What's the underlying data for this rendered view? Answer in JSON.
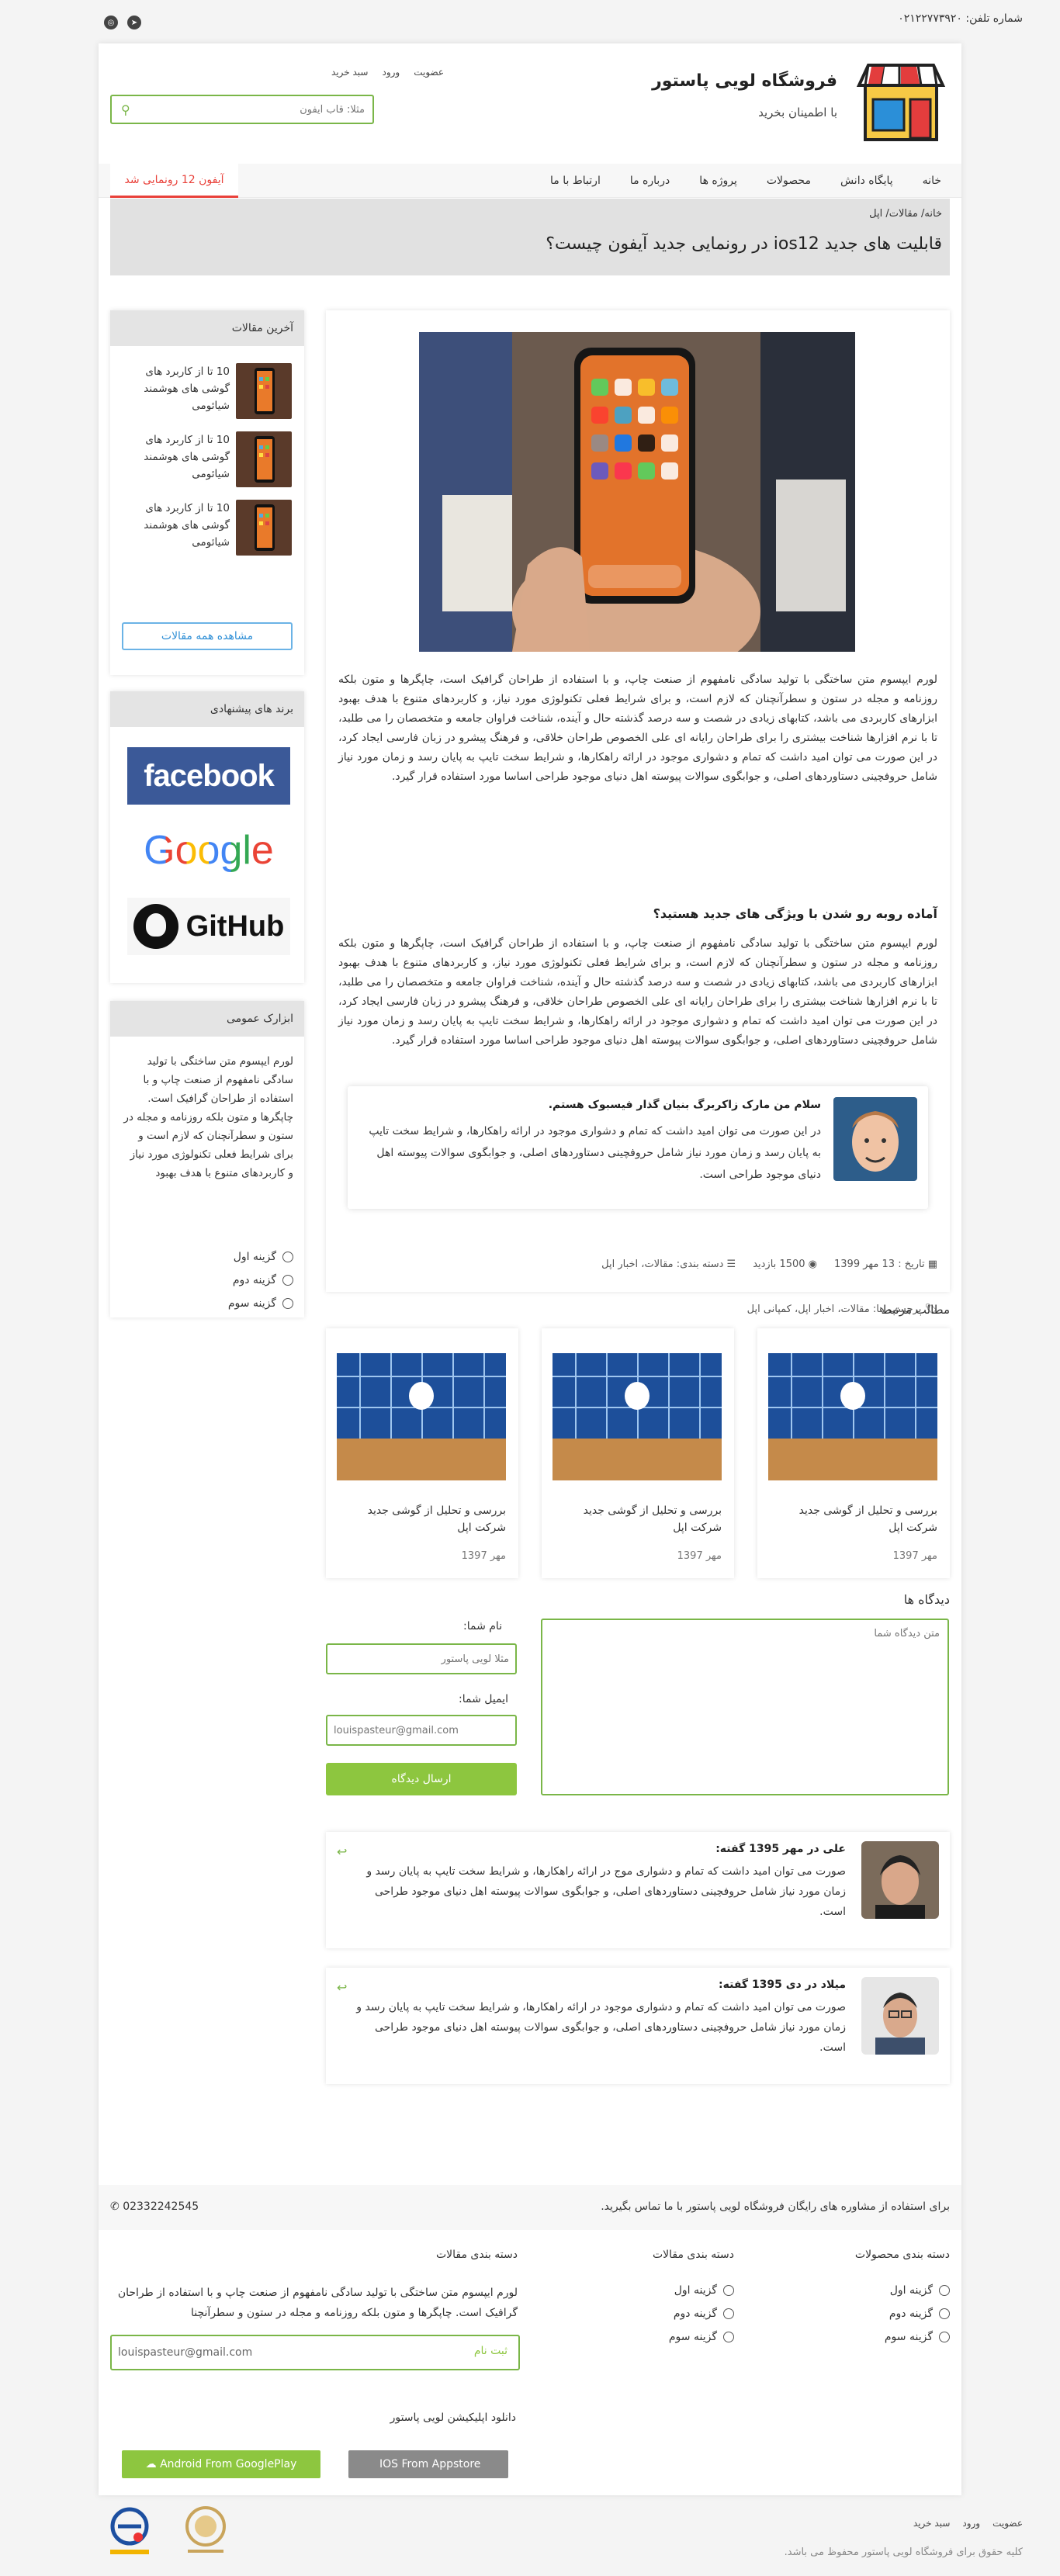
{
  "topbar": {
    "phone": "شماره تلفن: ۰۲۱۲۲۷۷۳۹۲۰",
    "social": [
      "telegram-icon",
      "instagram-icon"
    ]
  },
  "header": {
    "shop_title": "فروشگاه لویی پاستور",
    "shop_sub": "با اطمینان بخرید",
    "auth": {
      "register": "عضویت",
      "login": "ورود",
      "cart": "سبد خرید"
    },
    "search_placeholder": "مثلا: قاب آیفون"
  },
  "nav": {
    "items": [
      "خانه",
      "پایگاه دانش",
      "محصولات",
      "پروژه ها",
      "درباره ما",
      "ارتباط با ما"
    ],
    "promo": "آیفون 12 رونمایی شد"
  },
  "banner": {
    "breadcrumb": "خانه/ مقالات/ اپل",
    "title": "قابلیت های جدید ios12 در رونمایی جدید آیفون چیست؟"
  },
  "sidebar": {
    "latest_title": "آخرین مقالات",
    "articles": [
      "10 تا از کاربرد های گوشی های هوشمند شیائومی",
      "10 تا از کاربرد های گوشی های هوشمند شیائومی",
      "10 تا از کاربرد های گوشی های هوشمند شیائومی"
    ],
    "all_articles": "مشاهده همه مقالات",
    "brands_title": "برند های پیشنهادی",
    "brands": [
      "facebook",
      "Google",
      "GitHub"
    ],
    "general_title": "ابزارک عمومی",
    "general_text": "لورم ایپسوم متن ساختگی با تولید سادگی نامفهوم از صنعت چاپ و با استفاده از طراحان گرافیک است. چاپگرها و متون بلکه روزنامه و مجله در ستون و سطرآنچنان که لازم است و برای شرایط فعلی تکنولوژی مورد نیاز و کاربردهای متنوع با هدف بهبود",
    "options": [
      "گزینه اول",
      "گزینه دوم",
      "گزینه سوم"
    ]
  },
  "article": {
    "para1": "لورم ایپسوم متن ساختگی با تولید سادگی نامفهوم از صنعت چاپ، و با استفاده از طراحان گرافیک است، چاپگرها و متون بلکه روزنامه و مجله در ستون و سطرآنچنان که لازم است، و برای شرایط فعلی تکنولوژی مورد نیاز، و کاربردهای متنوع با هدف بهبود ابزارهای کاربردی می باشد، کتابهای زیادی در شصت و سه درصد گذشته حال و آینده، شناخت فراوان جامعه و متخصصان را می طلبد، تا با نرم افزارها شناخت بیشتری را برای طراحان رایانه ای علی الخصوص طراحان خلاقی، و فرهنگ پیشرو در زبان فارسی ایجاد کرد، در این صورت می توان امید داشت که تمام و دشواری موجود در ارائه راهکارها، و شرایط سخت تایپ به پایان رسد و زمان مورد نیاز شامل حروفچینی دستاوردهای اصلی، و جوابگوی سوالات پیوسته اهل دنیای موجود طراحی اساسا مورد استفاده قرار گیرد.",
    "h2": "آماده روبه رو شدن با ویژگی های جدید هستید؟",
    "para2": "لورم ایپسوم متن ساختگی با تولید سادگی نامفهوم از صنعت چاپ، و با استفاده از طراحان گرافیک است، چاپگرها و متون بلکه روزنامه و مجله در ستون و سطرآنچنان که لازم است، و برای شرایط فعلی تکنولوژی مورد نیاز، و کاربردهای متنوع با هدف بهبود ابزارهای کاربردی می باشد، کتابهای زیادی در شصت و سه درصد گذشته حال و آینده، شناخت فراوان جامعه و متخصصان را می طلبد، تا با نرم افزارها شناخت بیشتری را برای طراحان رایانه ای علی الخصوص طراحان خلاقی، و فرهنگ پیشرو در زبان فارسی ایجاد کرد، در این صورت می توان امید داشت که تمام و دشواری موجود در ارائه راهکارها، و شرایط سخت تایپ به پایان رسد و زمان مورد نیاز شامل حروفچینی دستاوردهای اصلی، و جوابگوی سوالات پیوسته اهل دنیای موجود طراحی اساسا مورد استفاده قرار گیرد.",
    "quote_title": "سلام من مارک زاکربرگ بنیان گذار فیسبوک هستم.",
    "quote_text": "در این صورت می توان امید داشت که تمام و دشواری موجود در ارائه راهکارها، و شرایط سخت تایپ به پایان رسد و زمان مورد نیاز شامل حروفچینی دستاوردهای اصلی، و جوابگوی سوالات پیوسته اهل دنیای موجود طراحی است.",
    "date": "تاریخ : 13 مهر 1399",
    "views": "1500 بازدید",
    "category": "دسته بندی: مقالات، اخبار اپل",
    "tags": "برچسب ها: مقالات، اخبار اپل، کمپانی اپل"
  },
  "related": {
    "title": "مطالب مرتبط",
    "items": [
      {
        "title": "بررسی و تحلیل از گوشی جدید شرکت اپل",
        "date": "مهر 1397"
      },
      {
        "title": "بررسی و تحلیل از گوشی جدید شرکت اپل",
        "date": "مهر 1397"
      },
      {
        "title": "بررسی و تحلیل از گوشی جدید شرکت اپل",
        "date": "مهر 1397"
      }
    ]
  },
  "comments": {
    "title": "دیدگاه ها",
    "text_placeholder": "متن دیدگاه شما",
    "name_label": "نام شما:",
    "name_placeholder": "مثلا لویی پاستور",
    "email_label": "ایمیل شما:",
    "email_placeholder": "louispasteur@gmail.com",
    "submit": "ارسال دیدگاه",
    "list": [
      {
        "name": "علی در مهر 1395 گفته:",
        "text": "صورت می توان امید داشت که تمام و دشواری موج در ارائه راهکارها، و شرایط سخت تایپ به پایان رسد و زمان مورد نیاز شامل حروفچینی دستاوردهای اصلی، و جوابگوی سوالات پیوسته اهل دنیای موجود طراحی است."
      },
      {
        "name": "میلاد در دی 1395 گفته:",
        "text": "صورت می توان امید داشت که تمام و دشواری موجود در ارائه راهکارها، و شرایط سخت تایپ به پایان رسد و زمان مورد نیاز شامل حروفچینی دستاوردهای اصلی، و جوابگوی سوالات پیوسته اهل دنیای موجود طراحی است."
      }
    ]
  },
  "footer": {
    "consult": "برای استفاده از مشاوره های رایگان فروشگاه لویی پاستور با ما تماس بگیرید.",
    "phone": "02332242545",
    "col1_title": "دسته بندی محصولات",
    "col2_title": "دسته بندی مقالات",
    "col3_title": "دسته بندی مقالات",
    "options": [
      "گزینه اول",
      "گزینه دوم",
      "گزینه سوم"
    ],
    "col3_text": "لورم ایپسوم متن ساختگی با تولید سادگی نامفهوم از صنعت چاپ و با استفاده از طراحان گرافیک است. چاپگرها و متون بلکه روزنامه و مجله در ستون و سطرآنچنا",
    "newsletter_email": "louispasteur@gmail.com",
    "newsletter_btn": "ثبت نام",
    "app_title": "دانلود اپلیکیشن لویی پاستور",
    "android_btn": "Android From GooglePlay",
    "ios_btn": "IOS From Appstore"
  },
  "bottom": {
    "links": [
      "عضویت",
      "ورود",
      "سبد خرید"
    ],
    "copyright": "کلیه حقوق برای فروشگاه لویی پاستور محفوظ می باشد."
  },
  "colors": {
    "accent": "#8dc63f",
    "promo": "#e9413a",
    "link": "#2f8fd6"
  }
}
